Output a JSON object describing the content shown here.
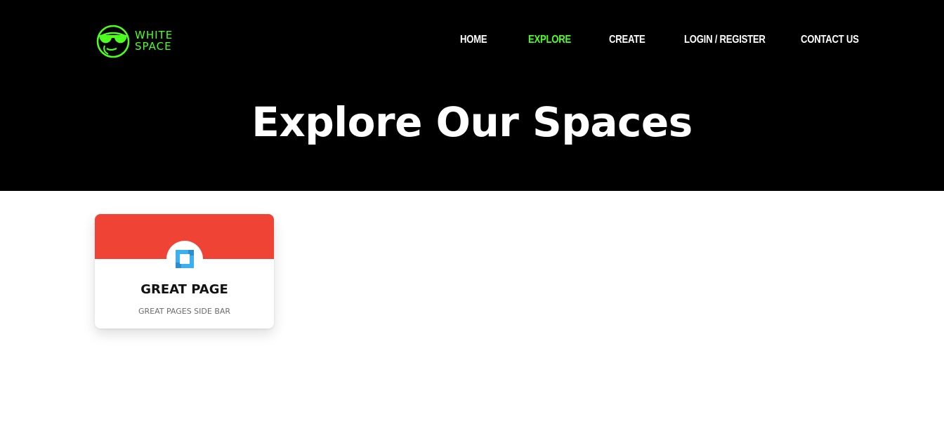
{
  "brand": {
    "line1": "WHITE",
    "line2": "SPACE",
    "logo_icon": "sunglasses-monkey-icon",
    "accent_color": "#4dff1f"
  },
  "nav": {
    "items": [
      {
        "label": "HOME",
        "active": false
      },
      {
        "label": "EXPLORE",
        "active": true
      },
      {
        "label": "CREATE",
        "active": false
      },
      {
        "label": "LOGIN / REGISTER",
        "active": false
      },
      {
        "label": "CONTACT US",
        "active": false
      }
    ]
  },
  "hero": {
    "title": "Explore Our Spaces",
    "background_color": "#000000"
  },
  "spaces": [
    {
      "title": "GREAT PAGE",
      "subtitle": "GREAT PAGES SIDE BAR",
      "banner_color": "#ee4335",
      "icon": "square-bracket-logo-icon",
      "icon_color": "#3ab0f0"
    }
  ]
}
